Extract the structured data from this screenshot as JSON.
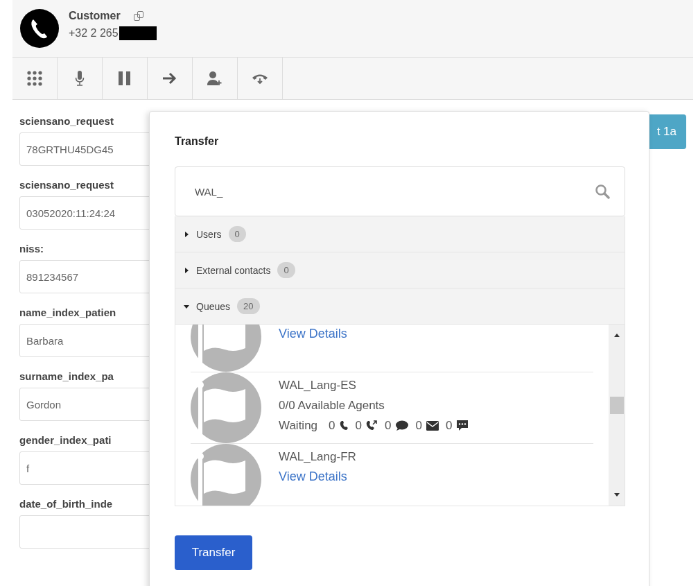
{
  "call": {
    "title": "Customer",
    "number": "+32 2 265",
    "redacted": true
  },
  "toolbar": [
    {
      "kind": "dialpad"
    },
    {
      "kind": "mic"
    },
    {
      "kind": "pause"
    },
    {
      "kind": "transfer"
    },
    {
      "kind": "add-person"
    },
    {
      "kind": "hangup"
    }
  ],
  "form": [
    {
      "label": "sciensano_request",
      "value": "78GRTHU45DG45"
    },
    {
      "label": "sciensano_request",
      "value": "03052020:11:24:24"
    },
    {
      "label": "niss:",
      "value": "891234567"
    },
    {
      "label": "name_index_patien",
      "value": "Barbara"
    },
    {
      "label": "surname_index_pa",
      "value": "Gordon"
    },
    {
      "label": "gender_index_pati",
      "value": "f"
    },
    {
      "label": "date_of_birth_inde"
    }
  ],
  "background_button": {
    "label": "t 1a"
  },
  "transfer": {
    "title": "Transfer",
    "search": {
      "value": "WAL_"
    },
    "sections": [
      {
        "label": "Users",
        "count": "0",
        "expanded": false
      },
      {
        "label": "External contacts",
        "count": "0",
        "expanded": false
      },
      {
        "label": "Queues",
        "count": "20",
        "expanded": true
      }
    ],
    "queues": [
      {
        "link": "View Details"
      },
      {
        "name": "WAL_Lang-ES",
        "agents": "0/0 Available Agents",
        "waiting": {
          "label": "Waiting",
          "counts": [
            {
              "kind": "call",
              "value": "0"
            },
            {
              "kind": "callback",
              "value": "0"
            },
            {
              "kind": "chat",
              "value": "0"
            },
            {
              "kind": "email",
              "value": "0"
            },
            {
              "kind": "message",
              "value": "0"
            }
          ]
        }
      },
      {
        "name": "WAL_Lang-FR",
        "link": "View Details"
      }
    ],
    "button": "Transfer"
  }
}
